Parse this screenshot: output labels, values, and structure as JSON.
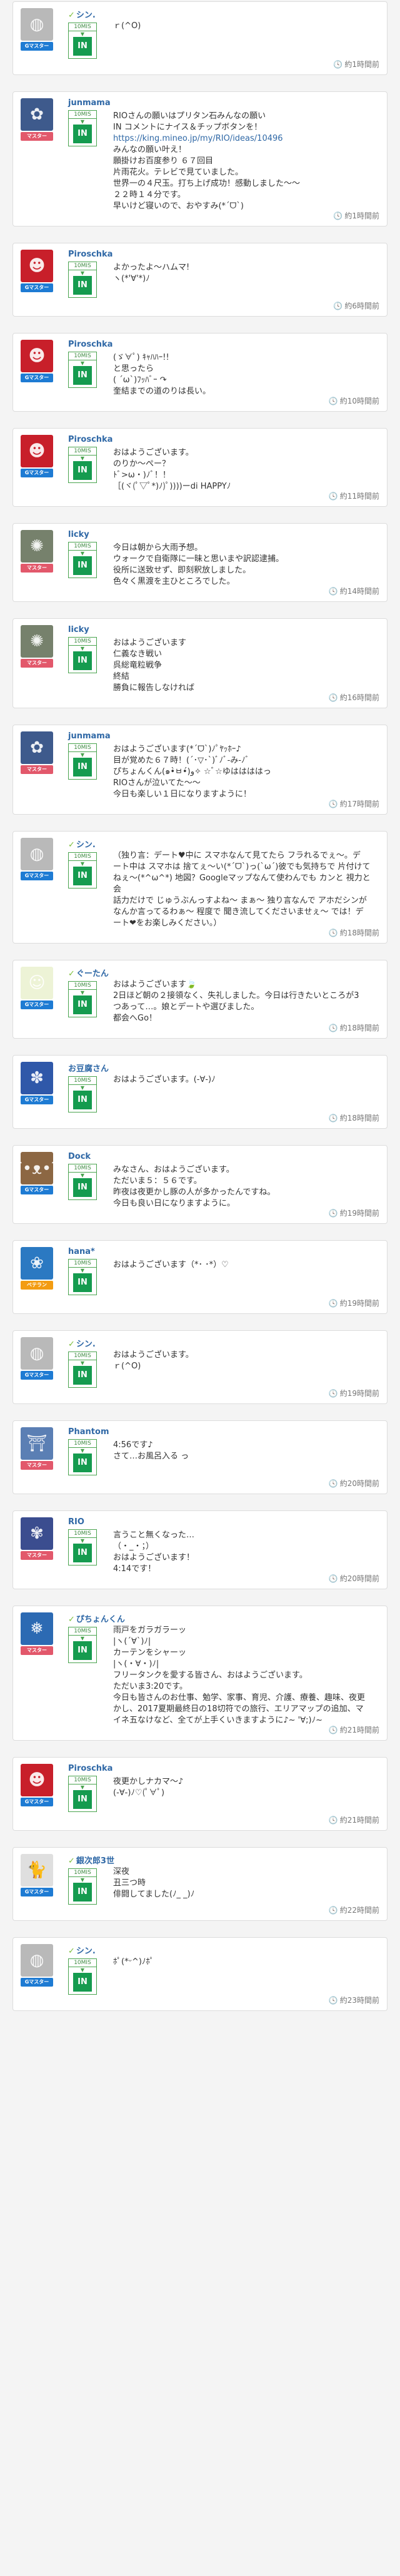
{
  "checkin_time": "10MIS",
  "checkin_label": "IN",
  "posts": [
    {
      "user": "シン.",
      "leaf": true,
      "rank": "Gマスター",
      "rank_color": "#1e7bd3",
      "avatar_bg": "#b9b9b9",
      "avatar_glyph": "◍",
      "time_ago": "約1時間前",
      "lines": [
        "ｒ(^O)"
      ]
    },
    {
      "user": "junmama",
      "leaf": false,
      "rank": "マスター",
      "rank_color": "#e2586b",
      "avatar_bg": "#3e5a8c",
      "avatar_glyph": "✿",
      "time_ago": "約1時間前",
      "lines": [
        "RIOさんの願いはプリタン石みんなの願い",
        "IN コメントにナイス＆チップボタンを！",
        "https://king.mineo.jp/my/RIO/ideas/10496",
        "みんなの願い叶え！",
        "願掛けお百度参り ６７回目",
        "片雨花火。テレビで見ていました。",
        "世界一の４尺玉。打ち上げ成功！感動しました〜〜",
        "２２時１４分です。",
        "早いけど寝いので、おやすみ(*ˊᗜˋ)"
      ]
    },
    {
      "user": "Piroschka",
      "leaf": false,
      "rank": "Gマスター",
      "rank_color": "#1e7bd3",
      "avatar_bg": "#c81f2a",
      "avatar_glyph": "☻",
      "time_ago": "約6時間前",
      "lines": [
        "よかったよ〜ハムマ!",
        "ヽ(*'∀'*)ﾉ"
      ]
    },
    {
      "user": "Piroschka",
      "leaf": false,
      "rank": "Gマスター",
      "rank_color": "#1e7bd3",
      "avatar_bg": "#c81f2a",
      "avatar_glyph": "☻",
      "time_ago": "約10時間前",
      "lines": [
        "(ゞ∀ﾟ) ｷｬﾊﾊｰ!!",
        "と思ったら",
        "( ´ω`)ﾌｯﾊﾞｰ ↷",
        "奎結までの道のりは長い。"
      ]
    },
    {
      "user": "Piroschka",
      "leaf": false,
      "rank": "Gマスター",
      "rank_color": "#1e7bd3",
      "avatar_bg": "#c81f2a",
      "avatar_glyph": "☻",
      "time_ago": "約11時間前",
      "lines": [
        "おはようございます。",
        "のりか〜ぺー？",
        "ﾄﾞ>ω・)ﾉﾞ！！",
        "［(ヾ(ﾟ▽ﾟ*)ﾉ)ﾟ))))ーdi HAPPYﾉ"
      ]
    },
    {
      "user": "licky",
      "leaf": false,
      "rank": "マスター",
      "rank_color": "#e2586b",
      "avatar_bg": "#76816c",
      "avatar_glyph": "✺",
      "time_ago": "約14時間前",
      "lines": [
        "今日は朝から大雨予想。",
        "ウォークで自衛隊に一昧と思いまや訳認逮捕。",
        "役所に送致せず、即刻釈放しました。",
        "色々く黒渡を主ひところでした。"
      ]
    },
    {
      "user": "licky",
      "leaf": false,
      "rank": "マスター",
      "rank_color": "#e2586b",
      "avatar_bg": "#76816c",
      "avatar_glyph": "✺",
      "time_ago": "約16時間前",
      "lines": [
        "おはようございます",
        "仁義なき戦い",
        "呉総竜粒戦争",
        "終結",
        "勝負に報告しなければ"
      ]
    },
    {
      "user": "junmama",
      "leaf": false,
      "rank": "マスター",
      "rank_color": "#e2586b",
      "avatar_bg": "#3e5a8c",
      "avatar_glyph": "✿",
      "time_ago": "約17時間前",
      "lines": [
        "おはようございます(*ˊᗜˋ)ﾉﾟﾔｯﾎｰ♪",
        "目が覚めた６７時！(´･▽･`)ﾞﾉﾞ-み-ﾉﾞ",
        "ぴちょんくん(๑•̀ㅂ•́)و✧ ☆ﾞ☆ゆははははっ",
        "RIOさんが泣いてた〜〜",
        "今日も楽しい１日になりますように！"
      ]
    },
    {
      "user": "シン.",
      "leaf": true,
      "rank": "Gマスター",
      "rank_color": "#1e7bd3",
      "avatar_bg": "#b9b9b9",
      "avatar_glyph": "◍",
      "time_ago": "約18時間前",
      "lines": [
        "（独り言：デート♥中に スマホなんて見てたら フラれるでぇ〜。デ",
        "ート中は スマホは 捨てぇ〜い(*ˊᗜˋ)っ(`ω´)彼でも気持ちで 片付けて",
        "ねぇ〜(*^ω^*) 地図？Googleマップなんて使わんでも カンと 視力と 会",
        "話力だけで じゅうぶんっすよね〜 まぁ〜 独り言なんで アホだシンが",
        "なんか言ってるわぁ〜 程度で 聞き流してくださいませぇ〜 では！デ",
        "ート❤をお楽しみください。）"
      ]
    },
    {
      "user": "ぐーたん",
      "leaf": true,
      "rank": "Gマスター",
      "rank_color": "#1e7bd3",
      "avatar_bg": "#edf3d6",
      "avatar_glyph": "☺",
      "time_ago": "約18時間前",
      "lines": [
        "おはようございます🍃",
        "2日ほど朝の２接領なく、失礼しました。今日は行きたいところが3",
        "つあって…。娘とデートや選びました。",
        "都会へGo！"
      ]
    },
    {
      "user": "お豆腐さん",
      "leaf": false,
      "rank": "Gマスター",
      "rank_color": "#1e7bd3",
      "avatar_bg": "#2f58a9",
      "avatar_glyph": "✽",
      "time_ago": "約18時間前",
      "lines": [
        "おはようございます。(-∀-)ﾉ"
      ]
    },
    {
      "user": "Dock",
      "leaf": false,
      "rank": "Gマスター",
      "rank_color": "#1e7bd3",
      "avatar_bg": "#8c6743",
      "avatar_glyph": "ʕ•ᴥ•ʔ",
      "time_ago": "約19時間前",
      "lines": [
        "みなさん、おはようございます。",
        "ただいま５：５６です。",
        "昨夜は夜更かし豚の人が多かったんですね。",
        "今日も良い日になりますように。"
      ]
    },
    {
      "user": "hana*",
      "leaf": false,
      "rank": "ベテラン",
      "rank_color": "#f39c12",
      "avatar_bg": "#2b79c2",
      "avatar_glyph": "❀",
      "time_ago": "約19時間前",
      "lines": [
        "おはようございます（*･ ･*）♡"
      ]
    },
    {
      "user": "シン.",
      "leaf": true,
      "rank": "Gマスター",
      "rank_color": "#1e7bd3",
      "avatar_bg": "#b9b9b9",
      "avatar_glyph": "◍",
      "time_ago": "約19時間前",
      "lines": [
        "おはようございます。",
        "ｒ(^O)"
      ]
    },
    {
      "user": "Phantom",
      "leaf": false,
      "rank": "マスター",
      "rank_color": "#e2586b",
      "avatar_bg": "#5b7fb4",
      "avatar_glyph": "⛩",
      "time_ago": "約20時間前",
      "lines": [
        "4:56です♪",
        "さて…お風呂入る っ"
      ]
    },
    {
      "user": "RIO",
      "leaf": false,
      "rank": "マスター",
      "rank_color": "#e2586b",
      "avatar_bg": "#3b4d8f",
      "avatar_glyph": "✾",
      "time_ago": "約20時間前",
      "lines": [
        "言うこと無くなった…",
        "（・_・；）",
        "おはようございます！",
        "4:14です！"
      ]
    },
    {
      "user": "ぴちょんくん",
      "leaf": true,
      "rank": "マスター",
      "rank_color": "#e2586b",
      "avatar_bg": "#2c6ab3",
      "avatar_glyph": "❅",
      "time_ago": "約21時間前",
      "lines": [
        "雨戸をガラガラーッ",
        "|ヽ(´∀`)ﾉ|",
        "カーテンをシャーッ",
        "|ヽ(・∀・)ﾉ|",
        "フリータンクを愛する皆さん、おはようございます。",
        "ただいま3:20です。",
        "今日も皆さんのお仕事、勉学、家事、育児、介護、療養、趣味、夜更",
        "かし、2017夏期最終日の18切符での旅行、エリアマップの追加、マ",
        "イネ五なけなど、全てが上手くいきますように♪~ '∀;)ﾉ~"
      ]
    },
    {
      "user": "Piroschka",
      "leaf": false,
      "rank": "Gマスター",
      "rank_color": "#1e7bd3",
      "avatar_bg": "#c81f2a",
      "avatar_glyph": "☻",
      "time_ago": "約21時間前",
      "lines": [
        "夜更かしナカマ〜♪",
        "(-∀-)ﾉ♡(ﾟ∀ﾟ)"
      ]
    },
    {
      "user": "銀次郎3世",
      "leaf": true,
      "rank": "Gマスター",
      "rank_color": "#1e7bd3",
      "avatar_bg": "#dfdfdf",
      "avatar_glyph": "🐈",
      "time_ago": "約22時間前",
      "lines": [
        "深夜",
        "丑三つ時",
        "俳闘してました(ﾉ_ _)ﾉ"
      ]
    },
    {
      "user": "シン.",
      "leaf": true,
      "rank": "Gマスター",
      "rank_color": "#1e7bd3",
      "avatar_bg": "#b9b9b9",
      "avatar_glyph": "◍",
      "time_ago": "約23時間前",
      "lines": [
        "ﾎﾟ(*ᵕ^)ﾉﾎﾟ"
      ]
    }
  ]
}
